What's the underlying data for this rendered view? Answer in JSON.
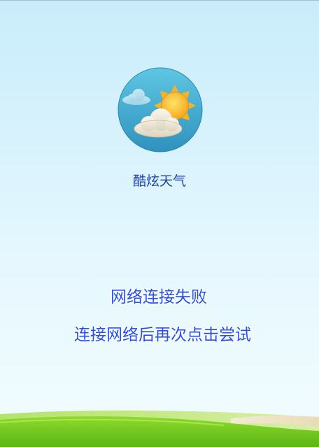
{
  "app": {
    "name": "酷炫天气",
    "logo_icon": "weather-sun-cloud-icon"
  },
  "error": {
    "title": "网络连接失败",
    "hint": "连接网络后再次点击尝试"
  },
  "colors": {
    "accent_text": "#2750e8",
    "app_name_text": "#1d3fb0",
    "background_top": "#c9ecfa",
    "ground_green": "#6fc51f"
  }
}
